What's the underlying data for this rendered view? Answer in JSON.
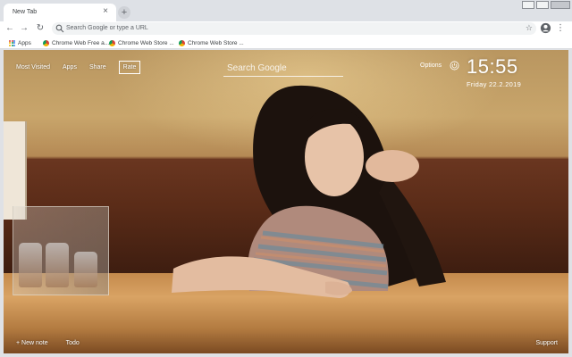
{
  "browser": {
    "tab_title": "New Tab",
    "tab_close": "×",
    "new_tab": "+",
    "omnibox_placeholder": "Search Google or type a URL",
    "bookmarks": [
      {
        "label": "Apps"
      },
      {
        "label": "Chrome Web Free a..."
      },
      {
        "label": "Chrome Web Store ..."
      },
      {
        "label": "Chrome Web Store ..."
      }
    ],
    "nav": {
      "back": "←",
      "forward": "→",
      "reload": "↻",
      "star": "☆",
      "menu": "⋮"
    }
  },
  "newtab": {
    "nav_links": [
      {
        "label": "Most Visited"
      },
      {
        "label": "Apps"
      },
      {
        "label": "Share"
      },
      {
        "label": "Rate"
      }
    ],
    "search_placeholder": "Search Google",
    "options_label": "Options",
    "clock": "15:55",
    "date": "Friday  22.2.2019",
    "bottom_links": [
      {
        "label": "+ New note"
      },
      {
        "label": "Todo"
      }
    ],
    "support_label": "Support"
  },
  "colors": {
    "chrome_bg": "#dee1e6",
    "overlay_text": "#ffffff",
    "wall": "#c8a56b",
    "booth": "#5b2c18",
    "table": "#d9a364"
  },
  "icons": {
    "bookmark_apps": "apps-grid-icon",
    "bookmark_store": "chrome-web-store-icon",
    "power": "power-icon",
    "profile": "account-circle-icon"
  }
}
